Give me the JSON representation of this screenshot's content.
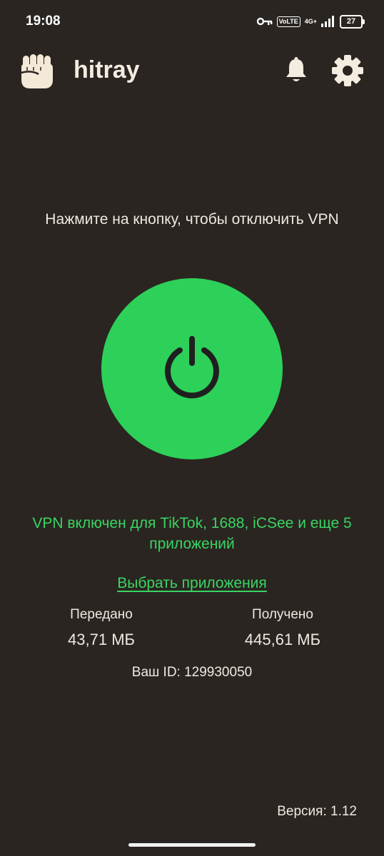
{
  "status_bar": {
    "time": "19:08",
    "volte": "VoLTE",
    "network": "4G+",
    "battery": "27"
  },
  "app_bar": {
    "title": "hitray"
  },
  "main": {
    "hint": "Нажмите на кнопку, чтобы отключить VPN",
    "vpn_status": "VPN включен для TikTok, 1688, iCSee и еще 5 приложений",
    "choose_apps": "Выбрать приложения",
    "stats": {
      "sent_label": "Передано",
      "sent_value": "43,71 МБ",
      "received_label": "Получено",
      "received_value": "445,61 МБ"
    },
    "user_id": "Ваш ID: 129930050",
    "version": "Версия: 1.12"
  },
  "colors": {
    "background": "#2a2521",
    "accent_green": "#2dd159",
    "text": "#efe9e1"
  },
  "icons": [
    "fist-icon",
    "key-icon",
    "signal-icon",
    "bell-icon",
    "gear-icon",
    "power-icon"
  ]
}
